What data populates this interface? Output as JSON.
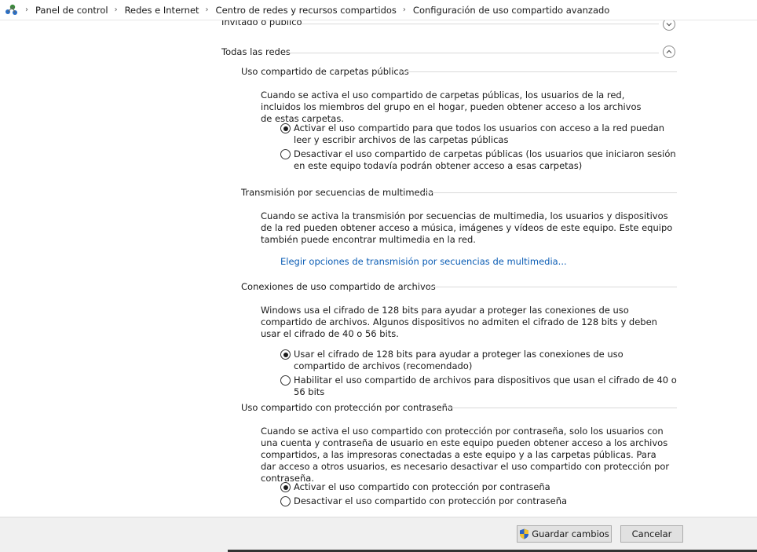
{
  "breadcrumb": {
    "items": [
      {
        "label": "Panel de control"
      },
      {
        "label": "Redes e Internet"
      },
      {
        "label": "Centro de redes y recursos compartidos"
      },
      {
        "label": "Configuración de uso compartido avanzado"
      }
    ],
    "separator": "›"
  },
  "groups": {
    "guest": {
      "title": "Invitado o público"
    },
    "all": {
      "title": "Todas las redes"
    }
  },
  "public_folders": {
    "heading": "Uso compartido de carpetas públicas",
    "description": "Cuando se activa el uso compartido de carpetas públicas, los usuarios de la red, incluidos los miembros del grupo en el hogar, pueden obtener acceso a los archivos de estas carpetas.",
    "option_on": "Activar el uso compartido para que todos los usuarios con acceso a la red puedan leer y escribir archivos de las carpetas públicas",
    "option_off": "Desactivar el uso compartido de carpetas públicas (los usuarios que iniciaron sesión en este equipo todavía podrán obtener acceso a esas carpetas)",
    "selected": "on"
  },
  "media_streaming": {
    "heading": "Transmisión por secuencias de multimedia",
    "description": "Cuando se activa la transmisión por secuencias de multimedia, los usuarios y dispositivos de la red pueden obtener acceso a música, imágenes y vídeos de este equipo. Este equipo también puede encontrar multimedia en la red.",
    "link": "Elegir opciones de transmisión por secuencias de multimedia..."
  },
  "file_sharing": {
    "heading": "Conexiones de uso compartido de archivos",
    "description": "Windows usa el cifrado de 128 bits para ayudar a proteger las conexiones de uso compartido de archivos. Algunos dispositivos no admiten el cifrado de 128 bits y deben usar el cifrado de 40 o 56 bits.",
    "option_128": "Usar el cifrado de 128 bits para ayudar a proteger las conexiones de uso compartido de archivos (recomendado)",
    "option_40_56": "Habilitar el uso compartido de archivos para dispositivos que usan el cifrado de 40 o 56 bits",
    "selected": "128"
  },
  "password_sharing": {
    "heading": "Uso compartido con protección por contraseña",
    "description": "Cuando se activa el uso compartido con protección por contraseña, solo los usuarios con una cuenta y contraseña de usuario en este equipo pueden obtener acceso a los archivos compartidos, a las impresoras conectadas a este equipo y a las carpetas públicas. Para dar acceso a otros usuarios, es necesario desactivar el uso compartido con protección por contraseña.",
    "option_on": "Activar el uso compartido con protección por contraseña",
    "option_off": "Desactivar el uso compartido con protección por contraseña",
    "selected": "on"
  },
  "footer": {
    "save_label": "Guardar cambios",
    "cancel_label": "Cancelar"
  },
  "icons": {
    "network": "network-icon",
    "chevron": "chevron-icon",
    "shield": "uac-shield-icon"
  },
  "colors": {
    "link": "#0a5cb4",
    "footer_bg": "#f0f0f0"
  }
}
